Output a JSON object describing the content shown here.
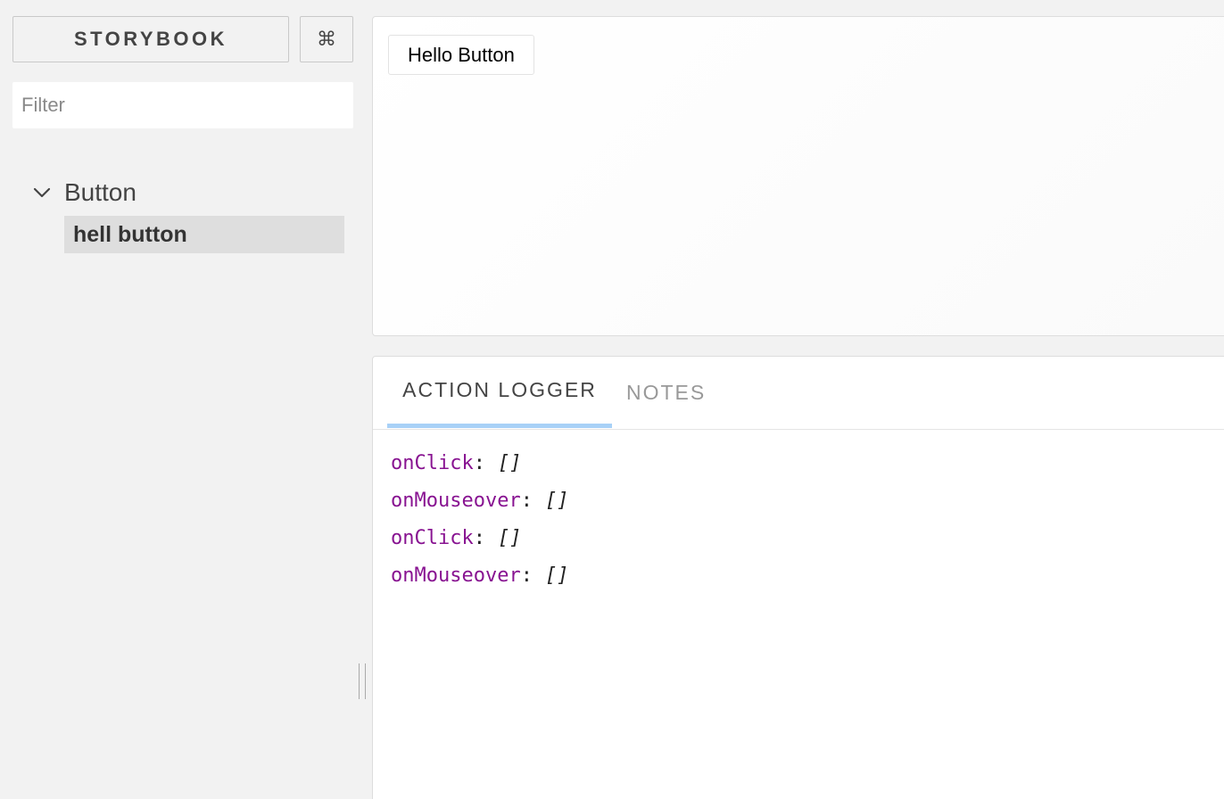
{
  "sidebar": {
    "brand_label": "STORYBOOK",
    "shortcut_label": "⌘",
    "filter_placeholder": "Filter",
    "kind": {
      "label": "Button",
      "expanded": true
    },
    "stories": [
      {
        "label": "hell button",
        "selected": true
      }
    ]
  },
  "preview": {
    "button_label": "Hello Button"
  },
  "addons": {
    "tabs": [
      {
        "label": "ACTION LOGGER",
        "active": true
      },
      {
        "label": "NOTES",
        "active": false
      }
    ],
    "actions": [
      {
        "name": "onClick",
        "separator": ":",
        "value": "[]"
      },
      {
        "name": "onMouseover",
        "separator": ":",
        "value": "[]"
      },
      {
        "name": "onClick",
        "separator": ":",
        "value": "[]"
      },
      {
        "name": "onMouseover",
        "separator": ":",
        "value": "[]"
      }
    ]
  },
  "colors": {
    "background": "#f2f2f2",
    "active_tab_underline": "#a8d1f7",
    "action_name": "#881391",
    "selected_story_bg": "#dedede"
  }
}
